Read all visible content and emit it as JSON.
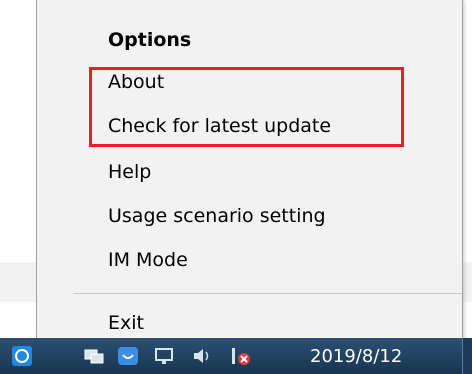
{
  "menu": {
    "items": [
      {
        "label": "Options"
      },
      {
        "label": "About"
      },
      {
        "label": "Check for latest update"
      },
      {
        "label": "Help"
      },
      {
        "label": "Usage scenario setting"
      },
      {
        "label": "IM Mode"
      },
      {
        "label": "Exit"
      }
    ]
  },
  "taskbar": {
    "clock_date": "2019/8/12"
  },
  "annotation": {
    "highlight_color": "#e8202a"
  }
}
